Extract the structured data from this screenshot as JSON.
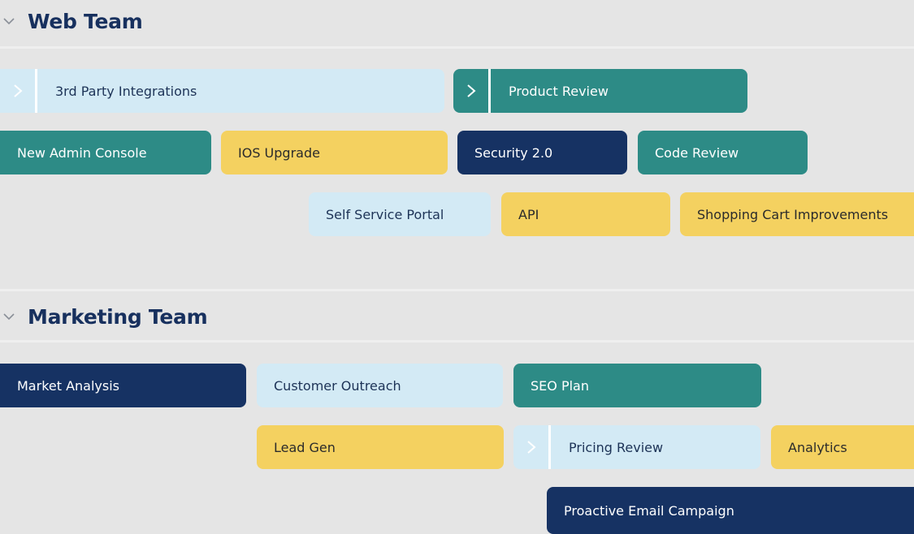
{
  "colors": {
    "teal": "#2d8b86",
    "yellow": "#f4d160",
    "navy": "#163263",
    "light_blue": "#d3eaf5",
    "heading": "#17305e",
    "background": "#e5e5e5"
  },
  "groups": [
    {
      "title": "Web Team",
      "expanded": true,
      "items": [
        {
          "label": "3rd Party Integrations",
          "color": "light_blue",
          "expandable": true
        },
        {
          "label": "Product Review",
          "color": "teal",
          "expandable": true
        },
        {
          "label": "New Admin Console",
          "color": "teal",
          "expandable": false
        },
        {
          "label": "IOS Upgrade",
          "color": "yellow",
          "expandable": false
        },
        {
          "label": "Security 2.0",
          "color": "navy",
          "expandable": false
        },
        {
          "label": "Code Review",
          "color": "teal",
          "expandable": false
        },
        {
          "label": "Self Service Portal",
          "color": "light_blue",
          "expandable": false
        },
        {
          "label": "API",
          "color": "yellow",
          "expandable": false
        },
        {
          "label": "Shopping Cart Improvements",
          "color": "yellow",
          "expandable": false
        }
      ]
    },
    {
      "title": "Marketing Team",
      "expanded": true,
      "items": [
        {
          "label": "Market Analysis",
          "color": "navy",
          "expandable": false
        },
        {
          "label": "Customer Outreach",
          "color": "light_blue",
          "expandable": false
        },
        {
          "label": "SEO Plan",
          "color": "teal",
          "expandable": false
        },
        {
          "label": "Lead Gen",
          "color": "yellow",
          "expandable": false
        },
        {
          "label": "Pricing Review",
          "color": "light_blue",
          "expandable": true
        },
        {
          "label": "Analytics",
          "color": "yellow",
          "expandable": false
        },
        {
          "label": "Proactive Email Campaign",
          "color": "navy",
          "expandable": false
        }
      ]
    }
  ]
}
